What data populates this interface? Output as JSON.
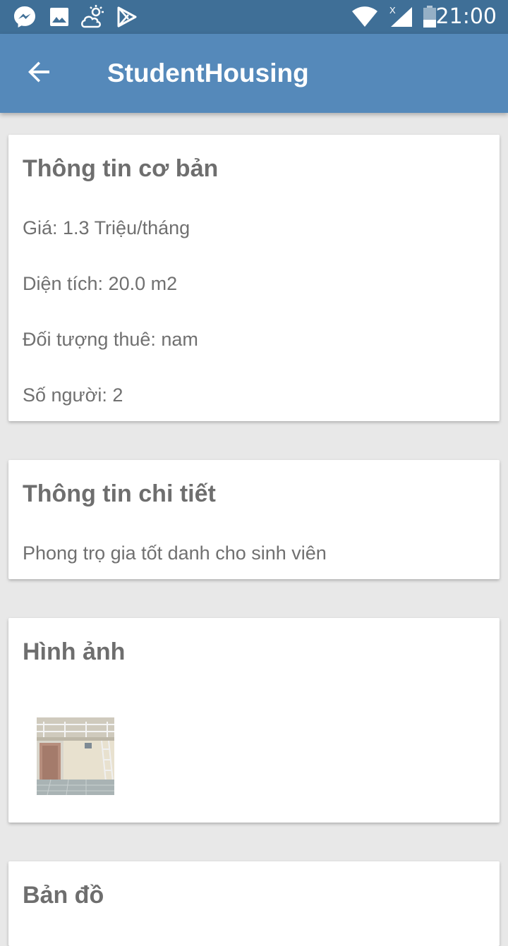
{
  "status_bar": {
    "time": "21:00",
    "icons": [
      "messenger-icon",
      "image-icon",
      "weather-icon",
      "play-store-icon",
      "wifi-icon",
      "signal-icon",
      "battery-icon"
    ]
  },
  "app_bar": {
    "title": "StudentHousing",
    "back_icon": "arrow-back-icon",
    "color": "#5589ba"
  },
  "basic_info": {
    "title": "Thông tin cơ bản",
    "price": "Giá: 1.3 Triệu/tháng",
    "area": "Diện tích: 20.0 m2",
    "tenant": "Đối tượng thuê: nam",
    "people": "Số người: 2"
  },
  "detail_info": {
    "title": "Thông tin chi tiết",
    "description": "Phong trọ gia tốt danh cho sinh viên"
  },
  "images": {
    "title": "Hình ảnh"
  },
  "map": {
    "title": "Bản đồ"
  }
}
